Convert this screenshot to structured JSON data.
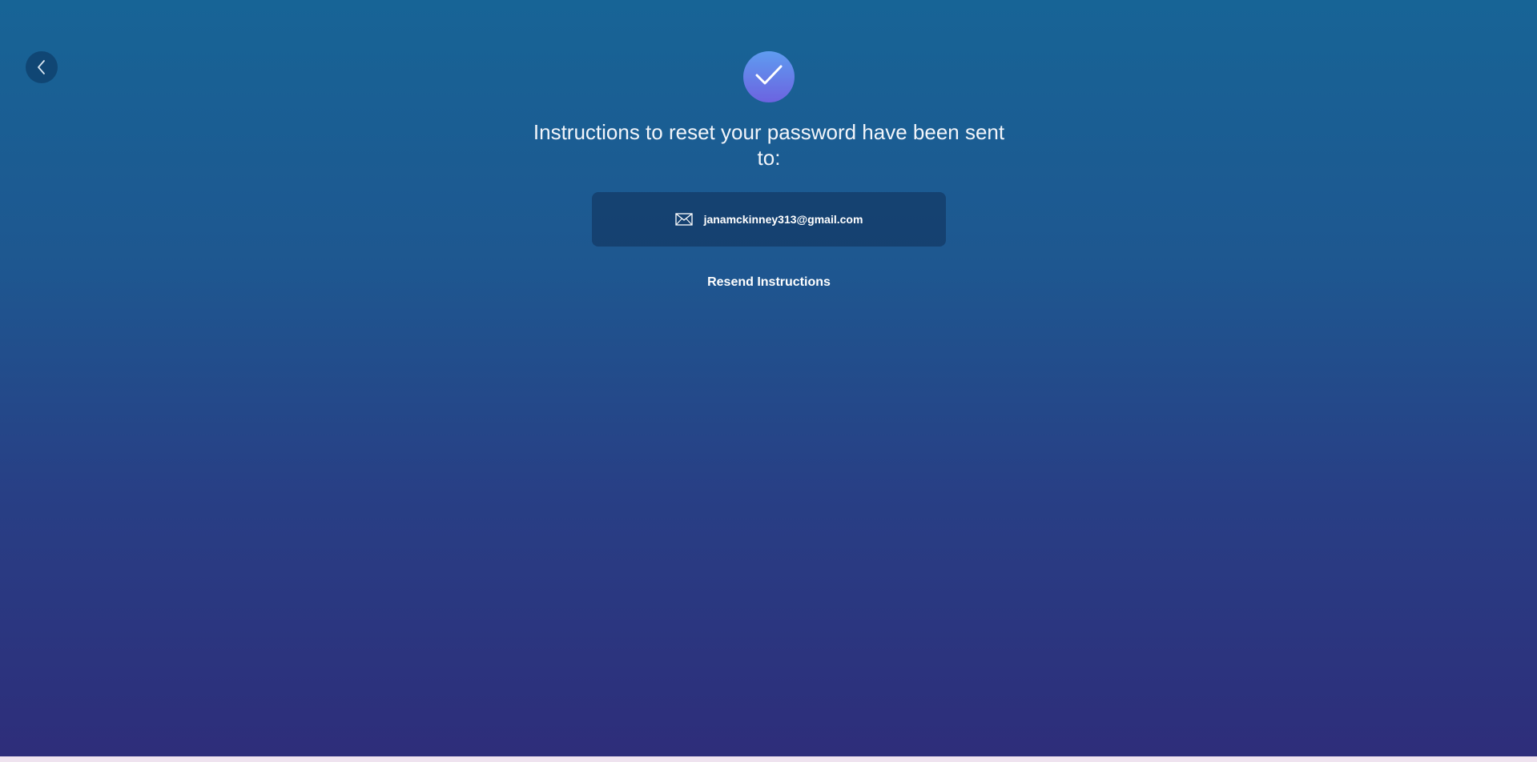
{
  "page": {
    "title_text": "Instructions to reset your password have been sent to:",
    "email_address": "janamckinney313@gmail.com",
    "resend_label": "Resend Instructions"
  },
  "icons": {
    "back": "chevron-left-icon",
    "success": "checkmark-icon",
    "email": "envelope-icon"
  },
  "colors": {
    "background_top": "#176496",
    "background_bottom": "#2e2d7a",
    "badge_top": "#5f9cf0",
    "badge_bottom": "#6c63e0",
    "email_box_bg": "#10325c",
    "text": "#ffffff"
  }
}
